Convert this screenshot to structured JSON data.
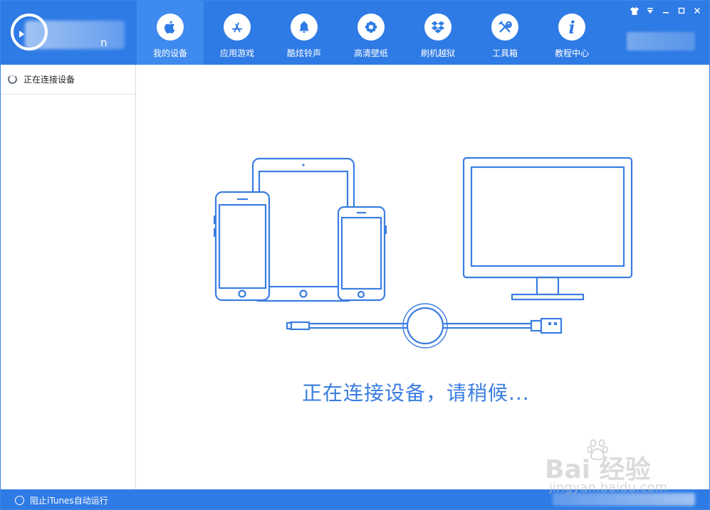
{
  "header": {
    "brand_suffix": "n",
    "nav": [
      {
        "label": "我的设备",
        "icon": "apple-icon",
        "active": true
      },
      {
        "label": "应用游戏",
        "icon": "app-store-icon",
        "active": false
      },
      {
        "label": "酷炫铃声",
        "icon": "bell-icon",
        "active": false
      },
      {
        "label": "高清壁纸",
        "icon": "flower-icon",
        "active": false
      },
      {
        "label": "刷机越狱",
        "icon": "dropbox-icon",
        "active": false
      },
      {
        "label": "工具箱",
        "icon": "tools-icon",
        "active": false
      },
      {
        "label": "教程中心",
        "icon": "info-icon",
        "active": false
      }
    ],
    "window_controls": [
      {
        "icon": "shirt-icon",
        "glyph": "👕"
      },
      {
        "icon": "dropdown-icon",
        "glyph": "▾"
      },
      {
        "icon": "minimize-icon",
        "glyph": "—"
      },
      {
        "icon": "maximize-icon",
        "glyph": "□"
      },
      {
        "icon": "close-icon",
        "glyph": "✕"
      }
    ]
  },
  "sidebar": {
    "device_status": "正在连接设备"
  },
  "main": {
    "status_message": "正在连接设备，请稍候..."
  },
  "footer": {
    "block_itunes_label": "阻止iTunes自动运行"
  },
  "watermark": {
    "main": "Bai 经验",
    "sub": "jingyan.baidu.com"
  },
  "colors": {
    "primary": "#2f7be5",
    "active_tab": "#3f8aee",
    "illustration_stroke": "#3a7de0"
  }
}
